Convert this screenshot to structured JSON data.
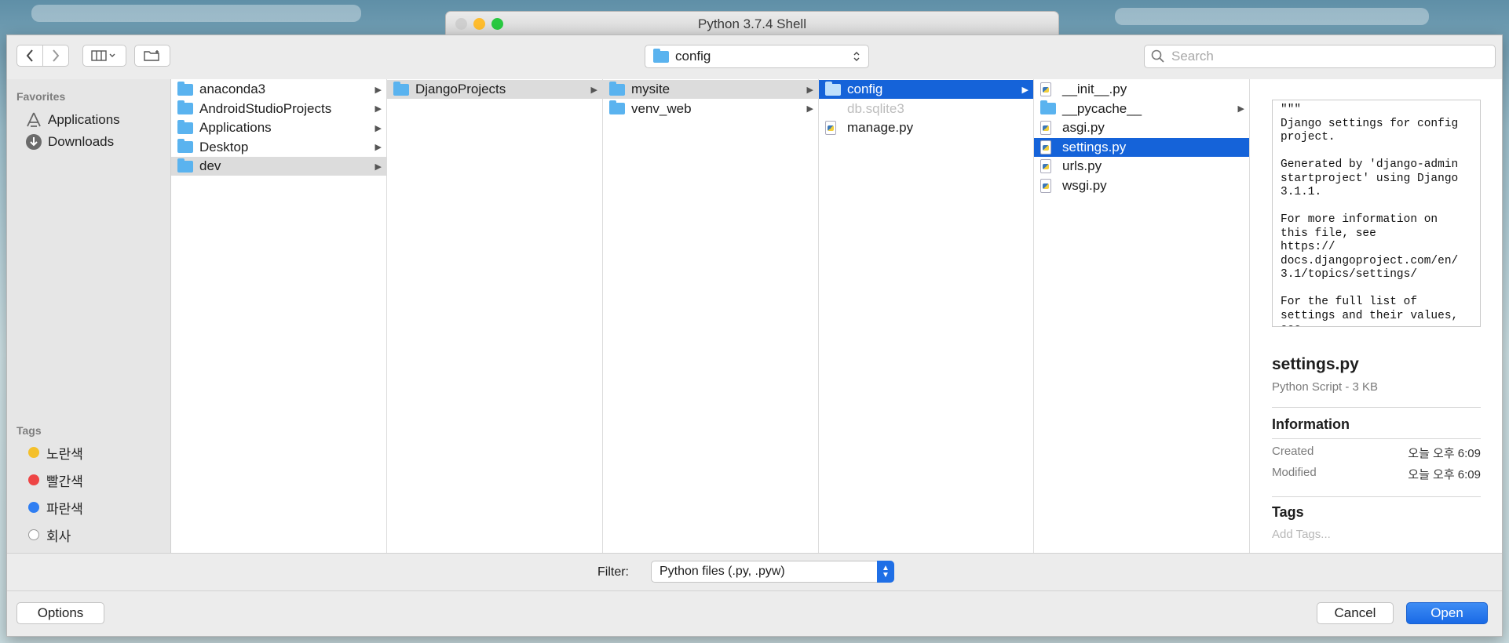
{
  "window": {
    "title": "Python 3.7.4 Shell"
  },
  "toolbar": {
    "path_popup": {
      "label": "config"
    },
    "search": {
      "placeholder": "Search"
    }
  },
  "sidebar": {
    "favorites_header": "Favorites",
    "favorites": [
      {
        "label": "Applications",
        "icon": "applications-icon"
      },
      {
        "label": "Downloads",
        "icon": "downloads-icon"
      }
    ],
    "tags_header": "Tags",
    "tags": [
      {
        "label": "노란색",
        "color": "#f4c02b"
      },
      {
        "label": "빨간색",
        "color": "#ee4545"
      },
      {
        "label": "파란색",
        "color": "#2f7ef2"
      },
      {
        "label": "회사",
        "color": "#ffffff"
      }
    ]
  },
  "columns": [
    {
      "items": [
        {
          "label": "anaconda3",
          "type": "folder",
          "has_children": true,
          "state": "normal"
        },
        {
          "label": "AndroidStudioProjects",
          "type": "folder",
          "has_children": true,
          "state": "normal"
        },
        {
          "label": "Applications",
          "type": "folder",
          "has_children": true,
          "state": "normal"
        },
        {
          "label": "Desktop",
          "type": "folder",
          "has_children": true,
          "state": "normal"
        },
        {
          "label": "dev",
          "type": "folder",
          "has_children": true,
          "state": "selected-inactive"
        }
      ]
    },
    {
      "items": [
        {
          "label": "DjangoProjects",
          "type": "folder",
          "has_children": true,
          "state": "selected-inactive"
        }
      ]
    },
    {
      "items": [
        {
          "label": "mysite",
          "type": "folder",
          "has_children": true,
          "state": "selected-inactive"
        },
        {
          "label": "venv_web",
          "type": "folder",
          "has_children": true,
          "state": "normal"
        }
      ]
    },
    {
      "items": [
        {
          "label": "config",
          "type": "folder",
          "has_children": true,
          "state": "selected"
        },
        {
          "label": "db.sqlite3",
          "type": "file",
          "has_children": false,
          "state": "disabled"
        },
        {
          "label": "manage.py",
          "type": "python",
          "has_children": false,
          "state": "normal"
        }
      ]
    },
    {
      "items": [
        {
          "label": "__init__.py",
          "type": "python",
          "has_children": false,
          "state": "normal"
        },
        {
          "label": "__pycache__",
          "type": "folder",
          "has_children": true,
          "state": "normal"
        },
        {
          "label": "asgi.py",
          "type": "python",
          "has_children": false,
          "state": "normal"
        },
        {
          "label": "settings.py",
          "type": "python",
          "has_children": false,
          "state": "selected"
        },
        {
          "label": "urls.py",
          "type": "python",
          "has_children": false,
          "state": "normal"
        },
        {
          "label": "wsgi.py",
          "type": "python",
          "has_children": false,
          "state": "normal"
        }
      ]
    }
  ],
  "preview": {
    "code": "\"\"\"\nDjango settings for config\nproject.\n\nGenerated by 'django-admin\nstartproject' using Django\n3.1.1.\n\nFor more information on\nthis file, see\nhttps://\ndocs.djangoproject.com/en/\n3.1/topics/settings/\n\nFor the full list of\nsettings and their values,\nsee",
    "file_name": "settings.py",
    "file_kind": "Python Script - 3 KB",
    "info_header": "Information",
    "created_label": "Created",
    "created_value": "오늘 오후 6:09",
    "modified_label": "Modified",
    "modified_value": "오늘 오후 6:09",
    "tags_header": "Tags",
    "add_tags_placeholder": "Add Tags..."
  },
  "filter": {
    "label": "Filter:",
    "selected": "Python files (.py, .pyw)"
  },
  "buttons": {
    "options": "Options",
    "cancel": "Cancel",
    "open": "Open"
  },
  "colors": {
    "accent": "#1563d9",
    "folder": "#5ab3ef",
    "close": "#fd5f57",
    "minimize": "#febc2e",
    "zoom": "#28c840"
  }
}
